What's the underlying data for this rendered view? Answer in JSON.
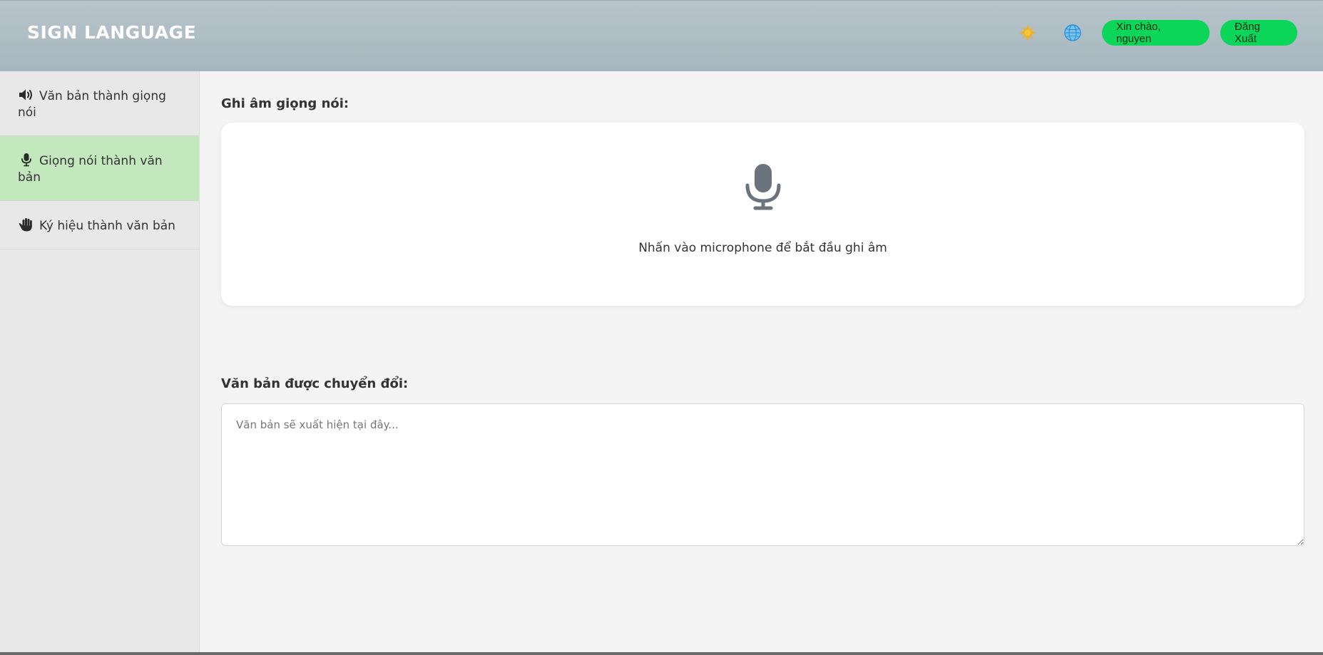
{
  "header": {
    "brand": "SIGN LANGUAGE",
    "theme_icon": "sun-icon",
    "language_icon": "globe-icon",
    "greeting_label": "Xin chào, nguyen",
    "logout_label": "Đăng Xuất"
  },
  "sidebar": {
    "items": [
      {
        "label": "Văn bản thành giọng nói",
        "icon": "speaker-icon",
        "active": false
      },
      {
        "label": "Giọng nói thành văn bản",
        "icon": "microphone-icon",
        "active": true
      },
      {
        "label": "Ký hiệu thành văn bản",
        "icon": "hand-icon",
        "active": false
      }
    ]
  },
  "main": {
    "record_title": "Ghi âm giọng nói:",
    "mic_hint": "Nhấn vào microphone để bắt đầu ghi âm",
    "output_title": "Văn bản được chuyển đổi:",
    "output_placeholder": "Văn bản sẽ xuất hiện tại đây...",
    "output_value": ""
  },
  "colors": {
    "header_gradient_top": "#b8c4cb",
    "header_gradient_bottom": "#a6b6be",
    "button_green": "#0bd65a",
    "active_sidebar": "#c3e8bd",
    "mic_gray": "#6c737c"
  }
}
